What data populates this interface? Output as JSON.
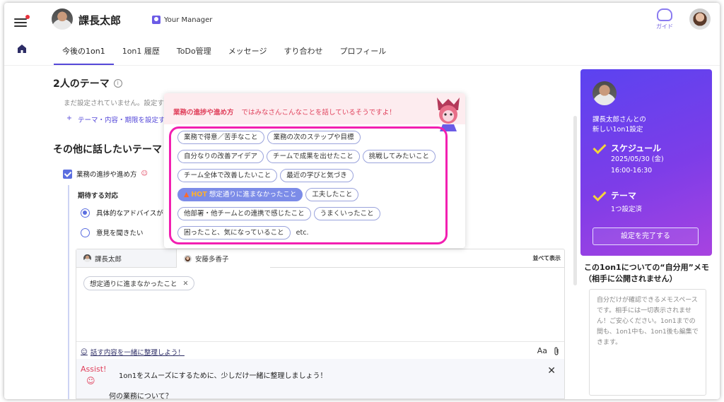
{
  "header": {
    "user_name": "課長太郎",
    "manager_badge": "Your Manager",
    "guide_label": "ガイド"
  },
  "tabs": [
    {
      "label": "今後の1on1",
      "active": true
    },
    {
      "label": "1on1 履歴",
      "active": false
    },
    {
      "label": "ToDo管理",
      "active": false
    },
    {
      "label": "メッセージ",
      "active": false
    },
    {
      "label": "すり合わせ",
      "active": false
    },
    {
      "label": "プロフィール",
      "active": false
    }
  ],
  "theme_section": {
    "title": "2人のテーマ",
    "empty_text": "まだ設定されていません。設定す",
    "add_link": "テーマ・内容・期限を設定す"
  },
  "other_section": {
    "title": "その他に話したいテーマ",
    "topic_label": "業務の進捗や進め方",
    "expected_title": "期待する対応",
    "option1": "具体的なアドバイスが",
    "option2": "意見を聞きたい"
  },
  "editor": {
    "tab1": "課長太郎",
    "tab2": "安藤多香子",
    "side_by_side": "並べて表示",
    "chip": "想定通りに進まなかったこと",
    "organize_link": "話す内容を一緒に整理しよう！",
    "font_icon_label": "Aa"
  },
  "assist": {
    "label": "Assist!",
    "message": "1on1をスムーズにするために、少しだけ一緒に整理しましょう！",
    "question": "何の業務について？"
  },
  "popup": {
    "category": "業務の進捗や進め方",
    "subtitle": "ではみなさんこんなことを話しているそうですよ！",
    "hot_label": "HOT",
    "rows": [
      [
        "業務で得意／苦手なこと",
        "業務の次のステップや目標"
      ],
      [
        "自分なりの改善アイデア",
        "チームで成果を出せたこと",
        "挑戦してみたいこと"
      ],
      [
        "チーム全体で改善したいこと",
        "最近の学びと気づき"
      ],
      [
        "想定通りに進まなかったこと",
        "工夫したこと"
      ],
      [
        "他部署・他チームとの連携で感じたこと",
        "うまくいったこと"
      ],
      [
        "困ったこと、気になっていること"
      ]
    ],
    "etc": "etc."
  },
  "side_panel": {
    "intro_line1": "課長太郎さんとの",
    "intro_line2": "新しい1on1設定",
    "schedule_title": "スケジュール",
    "schedule_date": "2025/05/30 (金)",
    "schedule_time": "16:00-16:30",
    "theme_title": "テーマ",
    "theme_status": "1つ設定済",
    "complete_button": "設定を完了する"
  },
  "memo": {
    "title_line1": "この1on1についての“自分用”メモ",
    "title_line2": "（相手に公開されません）",
    "placeholder": "自分だけが確認できるメモスペースです。相手には一切表示されません！ご安心ください。1on1までの間も、1on1中も、1on1後も編集できます。"
  },
  "colors": {
    "accent": "#5548d9",
    "highlight": "#f21fb1",
    "popup_header": "#fdecef",
    "hot_chip": "#7c8ce8"
  }
}
